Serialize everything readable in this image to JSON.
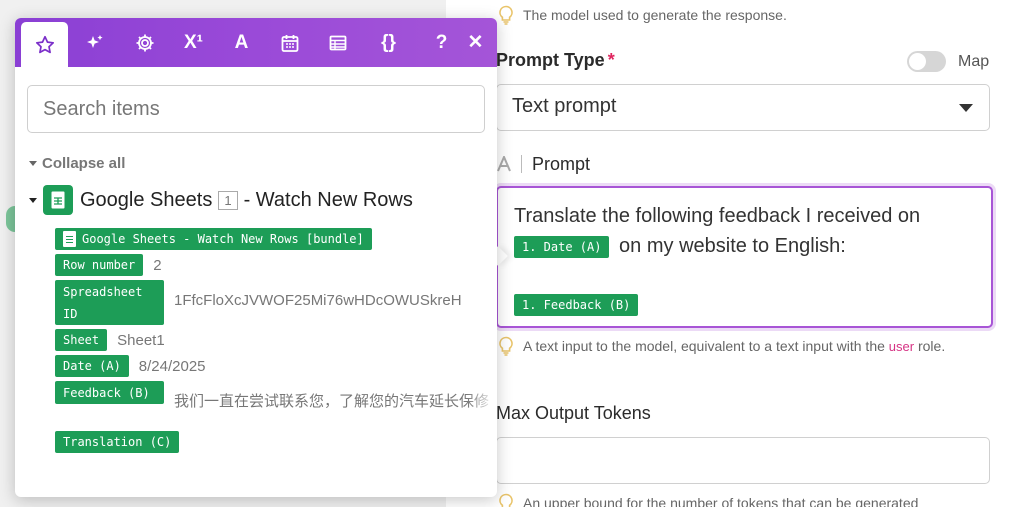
{
  "right_panel": {
    "model_hint": "The model used to generate the response.",
    "prompt_type_label": "Prompt Type",
    "required_mark": "*",
    "map_label": "Map",
    "prompt_type_value": "Text prompt",
    "prompt_label": "Prompt",
    "prompt_text_1": "Translate the following feedback I received on",
    "prompt_pill_date": "1. Date (A)",
    "prompt_text_2": "on my website to English:",
    "prompt_pill_feedback": "1. Feedback (B)",
    "prompt_hint_1": "A text input to the model, equivalent to a text input with the",
    "prompt_hint_user": "user",
    "prompt_hint_2": "role.",
    "max_tokens_label": "Max Output Tokens",
    "max_tokens_hint": "An upper bound for the number of tokens that can be generated"
  },
  "popup": {
    "tabs": [
      {
        "icon": "star-icon"
      },
      {
        "icon": "sparkles-icon"
      },
      {
        "icon": "gear-icon"
      },
      {
        "icon": "superscript-icon",
        "text": "X¹"
      },
      {
        "icon": "font-icon",
        "text": "A"
      },
      {
        "icon": "calendar-icon"
      },
      {
        "icon": "table-icon"
      },
      {
        "icon": "braces-icon",
        "text": "{}"
      },
      {
        "icon": "help-icon",
        "text": "?"
      },
      {
        "icon": "close-icon",
        "text": "✕"
      }
    ],
    "search_placeholder": "Search items",
    "collapse_all": "Collapse all",
    "module_name": "Google Sheets",
    "module_number": "1",
    "module_trigger": "- Watch New Rows",
    "items": [
      {
        "label": "Google Sheets - Watch New Rows [bundle]",
        "value": ""
      },
      {
        "label": "Row number",
        "value": "2"
      },
      {
        "label": "Spreadsheet ID",
        "value": "1FfcFloXcJVWOF25Mi76wHDcOWUSkreH"
      },
      {
        "label": "Sheet",
        "value": "Sheet1"
      },
      {
        "label": "Date (A)",
        "value": "8/24/2025"
      },
      {
        "label": "Feedback (B)",
        "value": "我们一直在尝试联系您，了解您的汽车延长保修"
      },
      {
        "label": "Translation (C)",
        "value": ""
      }
    ]
  },
  "colors": {
    "accent_purple": "#9a4ad8",
    "pill_green": "#1d9d57",
    "user_pink": "#d63384"
  }
}
